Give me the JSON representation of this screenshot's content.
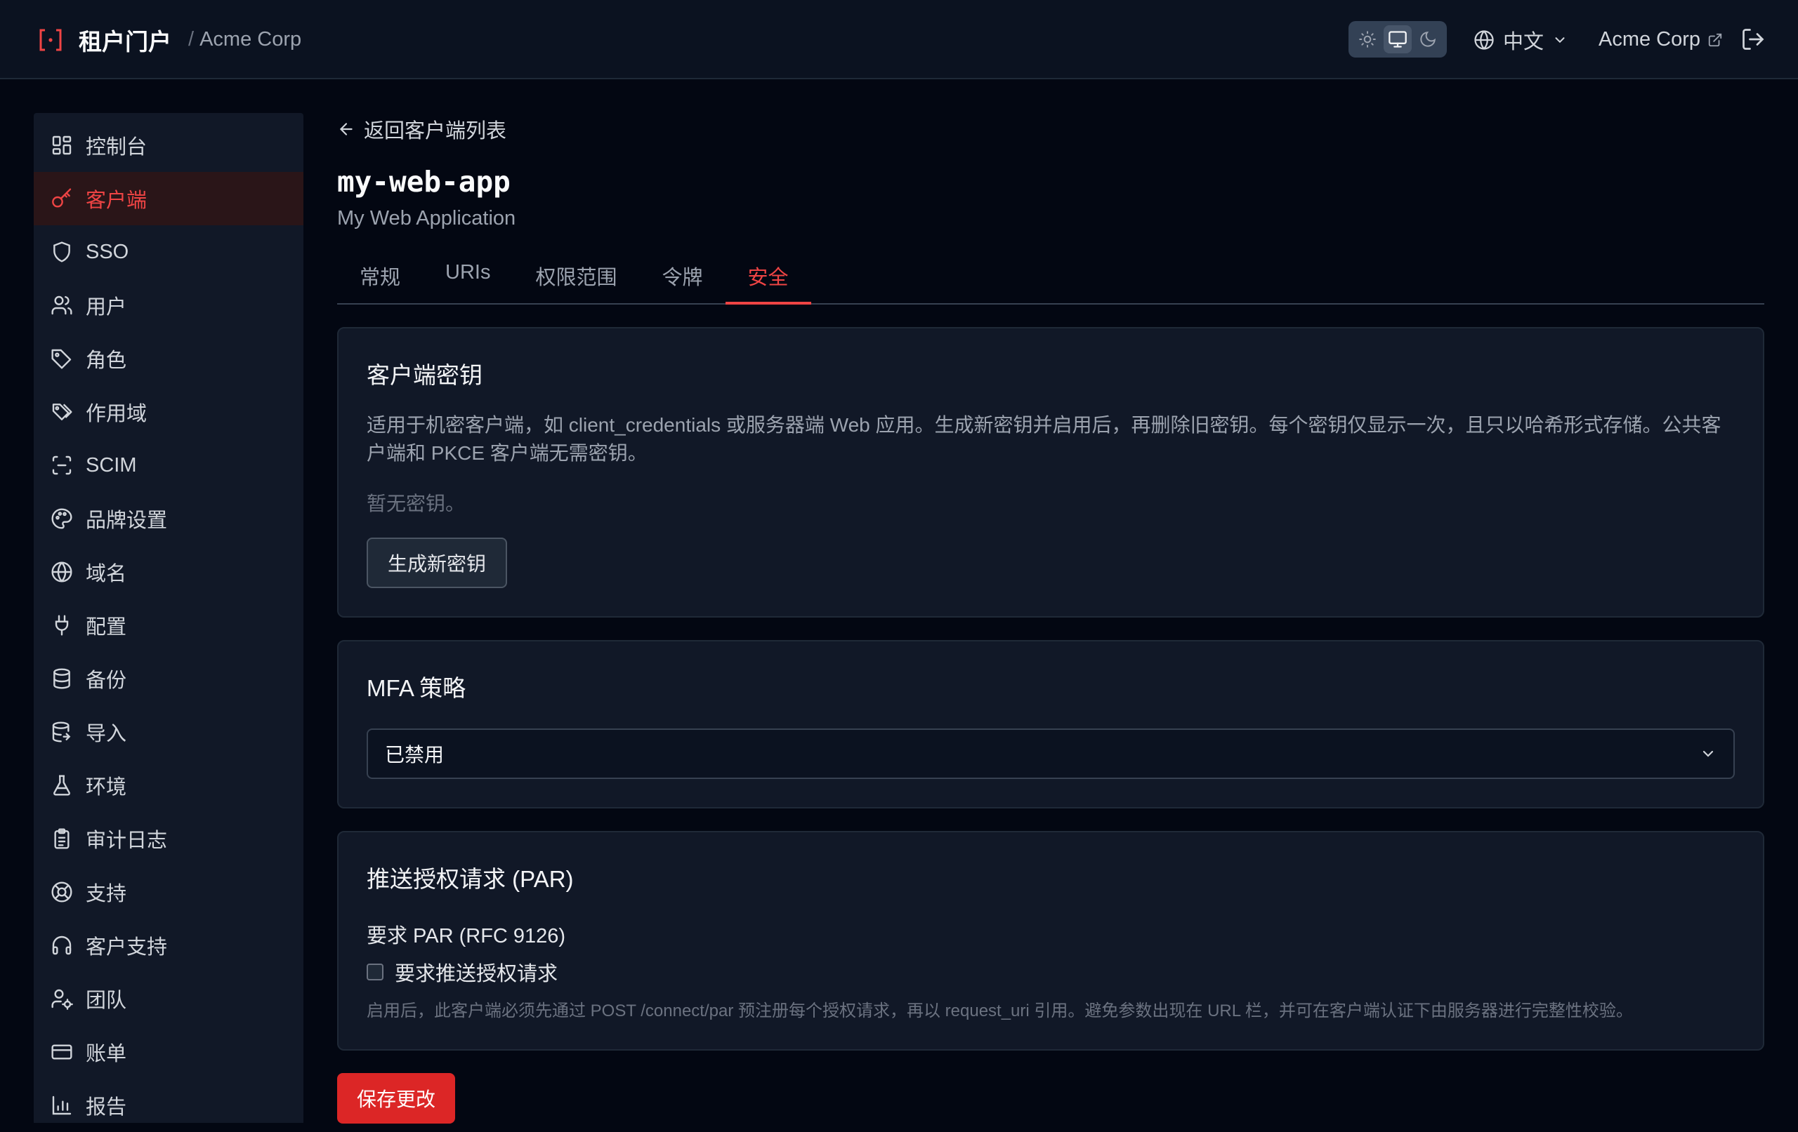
{
  "header": {
    "app_title": "租户门户",
    "separator": "/",
    "org_name": "Acme Corp",
    "theme_options": [
      "light",
      "system",
      "dark"
    ],
    "theme_selected": "system",
    "language": "中文",
    "org_link_label": "Acme Corp"
  },
  "colors": {
    "accent": "#ef4444",
    "primary_button": "#dc2626",
    "background": "#030712",
    "surface": "#111827"
  },
  "sidebar": {
    "items": [
      {
        "label": "控制台",
        "icon": "dashboard-icon"
      },
      {
        "label": "客户端",
        "icon": "key-icon",
        "active": true
      },
      {
        "label": "SSO",
        "icon": "shield-icon"
      },
      {
        "label": "用户",
        "icon": "users-icon"
      },
      {
        "label": "角色",
        "icon": "tag-icon"
      },
      {
        "label": "作用域",
        "icon": "tags-icon"
      },
      {
        "label": "SCIM",
        "icon": "scan-icon"
      },
      {
        "label": "品牌设置",
        "icon": "palette-icon"
      },
      {
        "label": "域名",
        "icon": "globe-icon"
      },
      {
        "label": "配置",
        "icon": "plug-icon"
      },
      {
        "label": "备份",
        "icon": "database-icon"
      },
      {
        "label": "导入",
        "icon": "database-import-icon"
      },
      {
        "label": "环境",
        "icon": "flask-icon"
      },
      {
        "label": "审计日志",
        "icon": "clipboard-icon"
      },
      {
        "label": "支持",
        "icon": "life-buoy-icon"
      },
      {
        "label": "客户支持",
        "icon": "headphones-icon"
      },
      {
        "label": "团队",
        "icon": "user-cog-icon"
      },
      {
        "label": "账单",
        "icon": "credit-card-icon"
      },
      {
        "label": "报告",
        "icon": "bar-chart-icon"
      }
    ]
  },
  "main": {
    "back_label": "返回客户端列表",
    "client_id": "my-web-app",
    "client_name": "My Web Application",
    "tabs": [
      {
        "label": "常规"
      },
      {
        "label": "URIs"
      },
      {
        "label": "权限范围"
      },
      {
        "label": "令牌"
      },
      {
        "label": "安全",
        "active": true
      }
    ],
    "secrets": {
      "title": "客户端密钥",
      "description": "适用于机密客户端，如 client_credentials 或服务器端 Web 应用。生成新密钥并启用后，再删除旧密钥。每个密钥仅显示一次，且只以哈希形式存储。公共客户端和 PKCE 客户端无需密钥。",
      "empty": "暂无密钥。",
      "generate_button": "生成新密钥"
    },
    "mfa": {
      "title": "MFA 策略",
      "selected": "已禁用"
    },
    "par": {
      "title": "推送授权请求 (PAR)",
      "field_label": "要求 PAR (RFC 9126)",
      "checkbox_label": "要求推送授权请求",
      "checked": false,
      "help": "启用后，此客户端必须先通过 POST /connect/par 预注册每个授权请求，再以 request_uri 引用。避免参数出现在 URL 栏，并可在客户端认证下由服务器进行完整性校验。"
    },
    "save_button": "保存更改"
  }
}
